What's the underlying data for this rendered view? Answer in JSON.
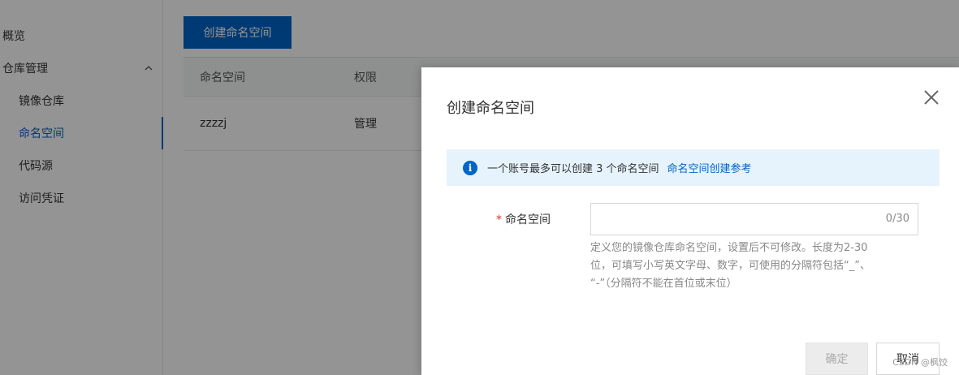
{
  "sidebar": {
    "items": [
      {
        "label": "概览"
      },
      {
        "label": "仓库管理"
      },
      {
        "label": "镜像仓库"
      },
      {
        "label": "命名空间"
      },
      {
        "label": "代码源"
      },
      {
        "label": "访问凭证"
      }
    ],
    "active": "命名空间",
    "accent": "#0064c8"
  },
  "toolbar": {
    "create_label": "创建命名空间"
  },
  "table": {
    "columns": [
      "命名空间",
      "权限"
    ],
    "rows": [
      [
        "zzzzj",
        "管理"
      ]
    ]
  },
  "dialog": {
    "title": "创建命名空间",
    "notice_text": "一个账号最多可以创建 3 个命名空间",
    "notice_link": "命名空间创建参考",
    "field_label": "命名空间",
    "field_value": "",
    "counter": "0/30",
    "help_line1": "定义您的镜像仓库命名空间，设置后不可修改。长度为2-30",
    "help_line2": "位，可填写小写英文字母、数字，可使用的分隔符包括“_”、",
    "help_line3": "“-”（分隔符不能在首位或末位）",
    "ok_label": "确定",
    "cancel_label": "取消"
  },
  "watermark": "CSDN @枫饺"
}
